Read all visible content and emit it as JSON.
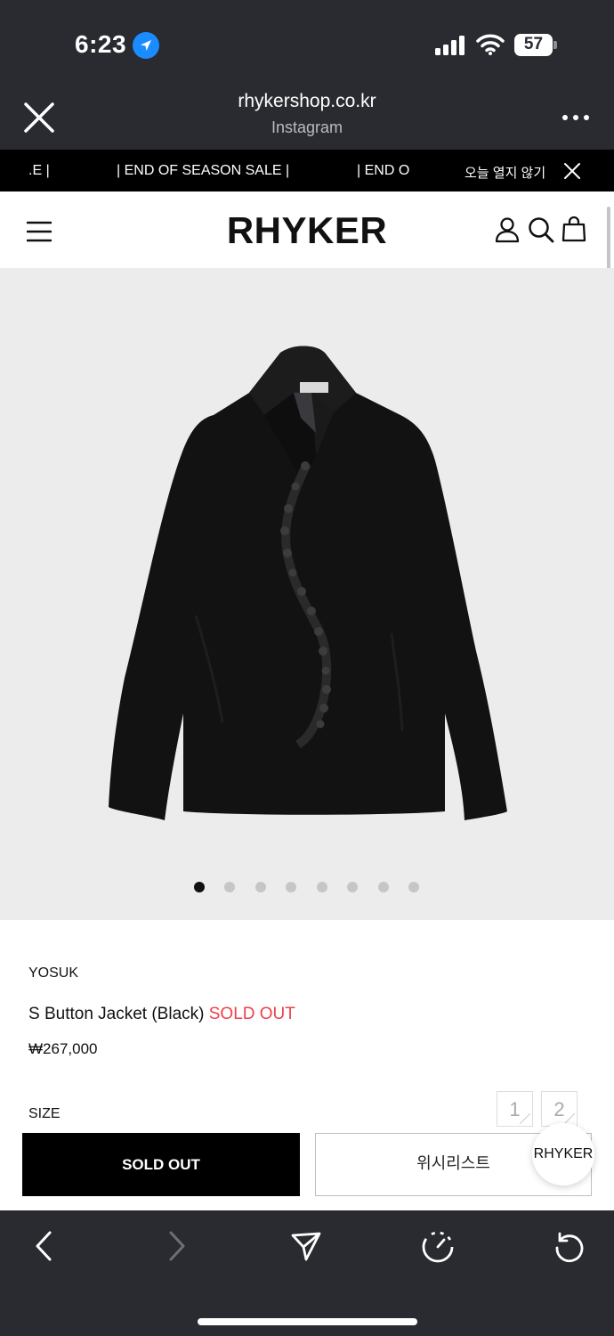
{
  "status_bar": {
    "time": "6:23",
    "battery": "57",
    "icons": [
      "location-arrow-icon",
      "signal-icon",
      "wifi-icon",
      "battery-icon"
    ]
  },
  "browser": {
    "url": "rhykershop.co.kr",
    "subtitle": "Instagram",
    "close_icon": "close-icon",
    "more_icon": "more-icon"
  },
  "marquee": {
    "segment_1": ".E |",
    "segment_2": "| END OF SEASON SALE |",
    "segment_3": "| END O",
    "close_label": "오늘 열지 않기"
  },
  "site_header": {
    "logo": "RHYKER",
    "icons": [
      "menu-icon",
      "user-icon",
      "search-icon",
      "shopping-bag-icon"
    ]
  },
  "carousel": {
    "total_slides": 8,
    "active_index": 0
  },
  "product": {
    "brand": "YOSUK",
    "name": "S Button Jacket (Black)",
    "status_tag": "SOLD OUT",
    "price": "₩267,000",
    "size_label": "SIZE",
    "sizes": [
      "1",
      "2"
    ],
    "soldout_button": "SOLD OUT",
    "wishlist_button": "위시리스트",
    "chat_label": "RHYKER"
  },
  "colors": {
    "chrome_bg": "#2a2b30",
    "accent_red": "#ef3f4a",
    "location_blue": "#1a8cff",
    "image_bg": "#ececec"
  },
  "toolbar": {
    "icons": [
      "back-icon",
      "forward-icon",
      "share-icon",
      "speed-icon",
      "reload-icon"
    ]
  }
}
